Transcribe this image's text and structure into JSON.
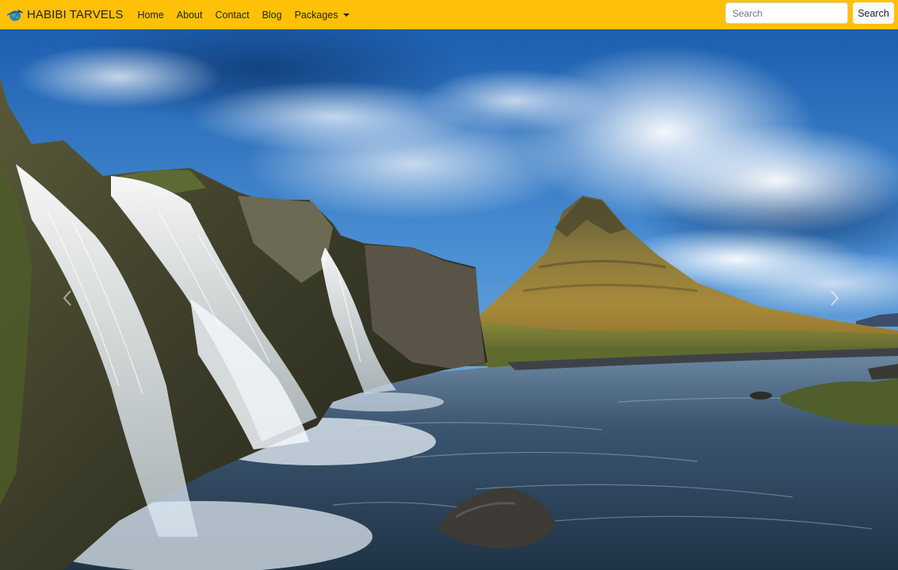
{
  "navbar": {
    "brand": "HABIBI TARVELS",
    "brand_icon": "globe-plane-icon",
    "links": [
      "Home",
      "About",
      "Contact",
      "Blog",
      "Packages"
    ],
    "background": "#ffc107"
  },
  "search": {
    "placeholder": "Search",
    "button_label": "Search"
  },
  "carousel": {
    "prev_icon": "chevron-left-icon",
    "next_icon": "chevron-right-icon"
  }
}
